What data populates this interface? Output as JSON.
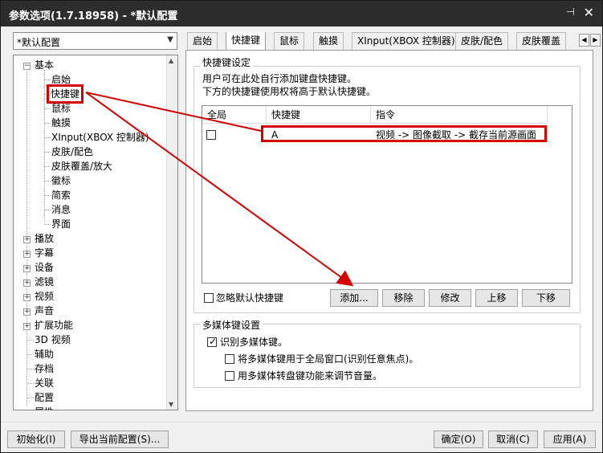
{
  "window": {
    "title": "参数选项(1.7.18958) - *默认配置",
    "pin_icon": "pin-icon",
    "close_icon": "close-icon"
  },
  "preset": {
    "value": "*默认配置"
  },
  "tree": {
    "basic": "基本",
    "basic_children": [
      "启始",
      "快捷键",
      "鼠标",
      "触摸",
      "XInput(XBOX 控制器)",
      "皮肤/配色",
      "皮肤覆盖/放大",
      "徽标",
      "简索",
      "消息",
      "界面"
    ],
    "others": [
      "播放",
      "字幕",
      "设备",
      "滤镜",
      "视频",
      "声音",
      "扩展功能"
    ],
    "leaves": [
      "3D 视频",
      "辅助",
      "存档",
      "关联",
      "配置",
      "属性"
    ]
  },
  "tabs": [
    "启始",
    "快捷键",
    "鼠标",
    "触摸",
    "XInput(XBOX 控制器)",
    "皮肤/配色",
    "皮肤覆盖"
  ],
  "hotkeys": {
    "group_title": "快捷键设定",
    "desc1": "用户可在此处自行添加键盘快捷键。",
    "desc2": "下方的快捷键使用权将高于默认快捷键。",
    "columns": [
      "全局",
      "快捷键",
      "指令"
    ],
    "rows": [
      {
        "global": false,
        "key": "A",
        "command": "视频 -> 图像截取 -> 截存当前源画面"
      }
    ],
    "ignore_default": "忽略默认快捷键",
    "buttons": {
      "add": "添加...",
      "remove": "移除",
      "modify": "修改",
      "up": "上移",
      "down": "下移"
    }
  },
  "media": {
    "group_title": "多媒体键设置",
    "recognize": "识别多媒体键。",
    "global_window": "将多媒体键用于全局窗口(识别任意焦点)。",
    "volume": "用多媒体转盘键功能来调节音量。"
  },
  "footer": {
    "reset": "初始化(I)",
    "export": "导出当前配置(S)...",
    "ok": "确定(O)",
    "cancel": "取消(C)",
    "apply": "应用(A)"
  },
  "colors": {
    "highlight": "#d40000",
    "titlebar": "#2d2d30"
  }
}
